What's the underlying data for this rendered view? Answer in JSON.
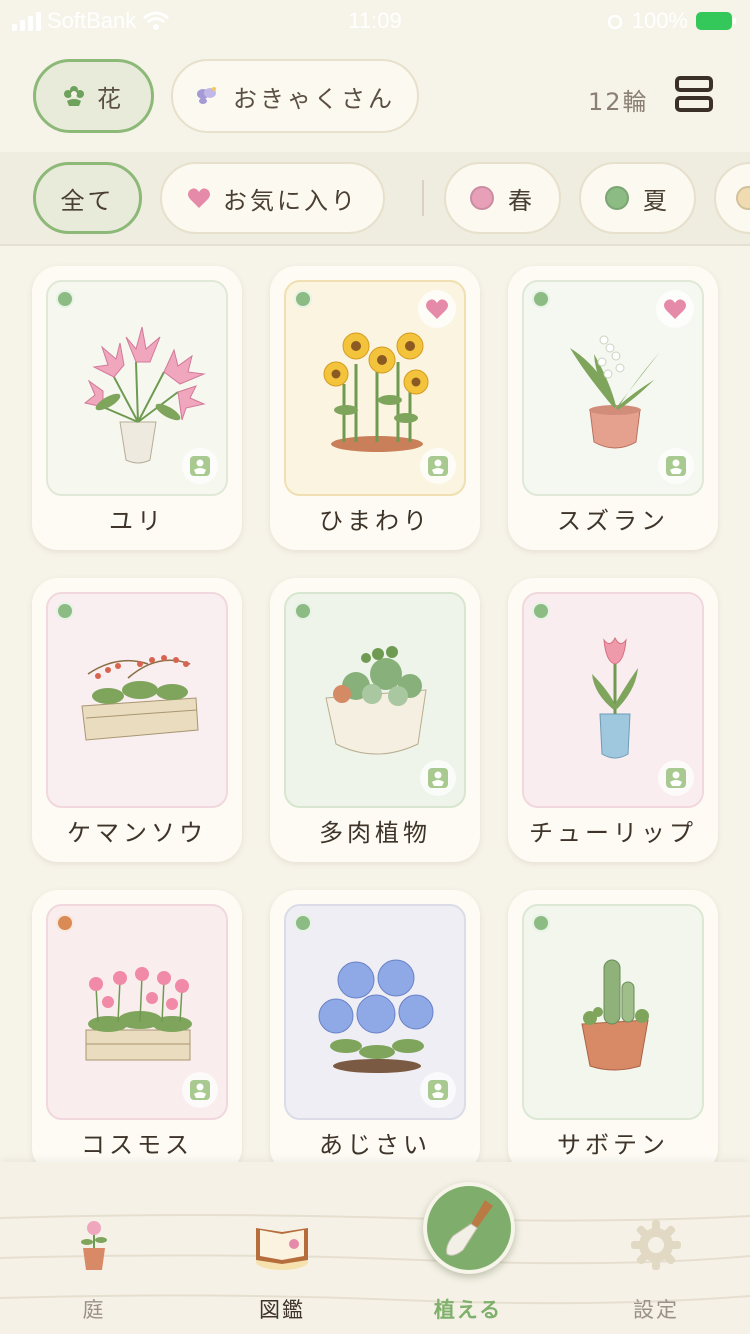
{
  "status_bar": {
    "carrier": "SoftBank",
    "time": "11:09",
    "battery": "100%"
  },
  "header": {
    "category_flower": "花",
    "category_guest": "おきゃくさん",
    "count": "12輪"
  },
  "filters": {
    "all": "全て",
    "favorites": "お気に入り",
    "spring": "春",
    "summer": "夏"
  },
  "colors": {
    "accent_green": "#8cb878",
    "status_green": "#8cbc84",
    "status_orange": "#d98a55",
    "spring_pink": "#e8a0b8",
    "summer_green": "#8cbc84",
    "heart_pink": "#e58aa8"
  },
  "cards": [
    {
      "name": "ユリ",
      "status": "green",
      "favorite": false
    },
    {
      "name": "ひまわり",
      "status": "green",
      "favorite": true
    },
    {
      "name": "スズラン",
      "status": "green",
      "favorite": true
    },
    {
      "name": "ケマンソウ",
      "status": "green",
      "favorite": false
    },
    {
      "name": "多肉植物",
      "status": "green",
      "favorite": false
    },
    {
      "name": "チューリップ",
      "status": "green",
      "favorite": false
    },
    {
      "name": "コスモス",
      "status": "orange",
      "favorite": false
    },
    {
      "name": "あじさい",
      "status": "green",
      "favorite": false
    },
    {
      "name": "サボテン",
      "status": "green",
      "favorite": false
    }
  ],
  "tabbar": {
    "garden": "庭",
    "encyclopedia": "図鑑",
    "plant": "植える",
    "settings": "設定"
  }
}
